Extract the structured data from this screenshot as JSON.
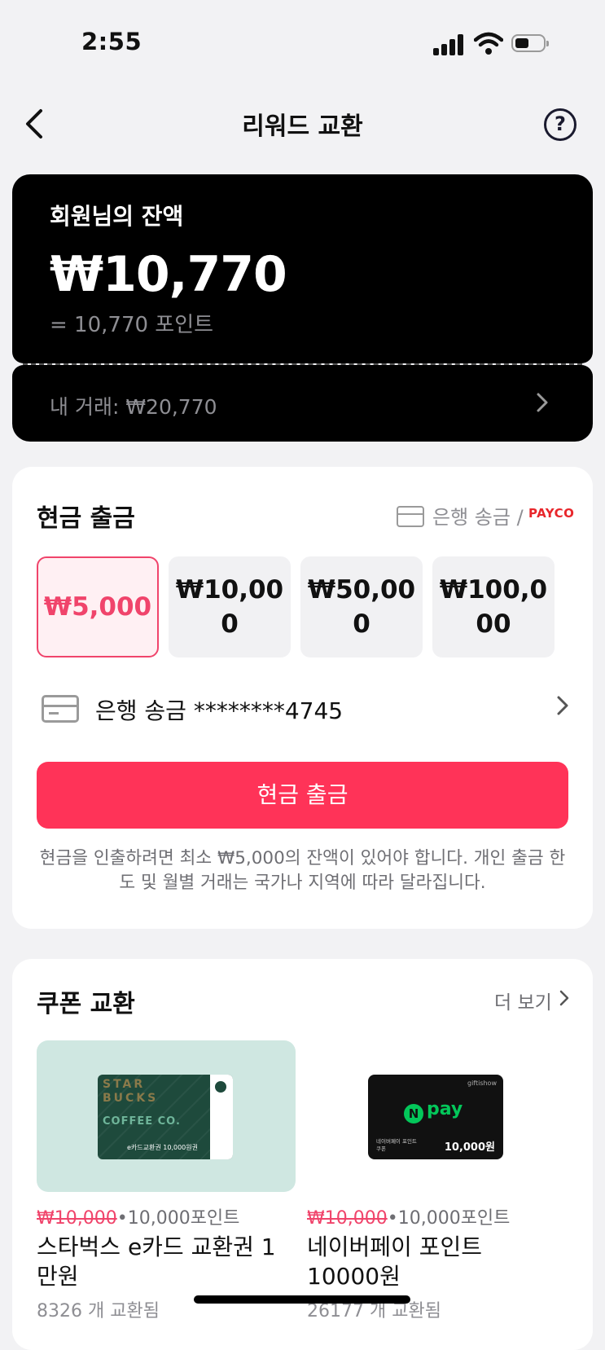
{
  "status_bar": {
    "time": "2:55"
  },
  "nav": {
    "title": "리워드 교환",
    "help_glyph": "?"
  },
  "balance": {
    "label": "회원님의 잔액",
    "amount": "₩10,770",
    "points": "= 10,770 포인트",
    "transactions": "내 거래: ₩20,770"
  },
  "cash": {
    "title": "현금 출금",
    "method_text": "은행 송금 /",
    "payco": "PAYCO",
    "amounts": [
      {
        "label": "₩5,000",
        "selected": true
      },
      {
        "label": "₩10,000",
        "selected": false
      },
      {
        "label": "₩50,000",
        "selected": false
      },
      {
        "label": "₩100,000",
        "selected": false
      }
    ],
    "bank_account": "은행 송금 ********4745",
    "button": "현금 출금",
    "notice": "현금을 인출하려면 최소 ₩5,000의 잔액이 있어야 합니다. 개인 출금 한도 및 월별 거래는 국가나 지역에 따라 달라집니다."
  },
  "coupons": {
    "title": "쿠폰 교환",
    "more": "더 보기",
    "items": [
      {
        "card_text": {
          "word": "STAR BUCKS",
          "coffee": "COFFEE CO.",
          "caption": "e카드교환권 10,000원권"
        },
        "original_price": "₩10,000",
        "points": "•10,000포인트",
        "name": "스타벅스 e카드 교환권 1만원",
        "count": "8326 개 교환됨"
      },
      {
        "card_text": {
          "brand": "giftishow",
          "logo": "N",
          "pay": "pay",
          "sub": "네이버페이 포인트 쿠폰",
          "amount": "10,000원"
        },
        "original_price": "₩10,000",
        "points": "•10,000포인트",
        "name": "네이버페이 포인트 10000원",
        "count": "26177 개 교환됨"
      }
    ]
  },
  "colors": {
    "accent": "#ff3358",
    "selected": "#f0446b",
    "card_bg": "#000000",
    "page_bg": "#f2f2f4"
  }
}
